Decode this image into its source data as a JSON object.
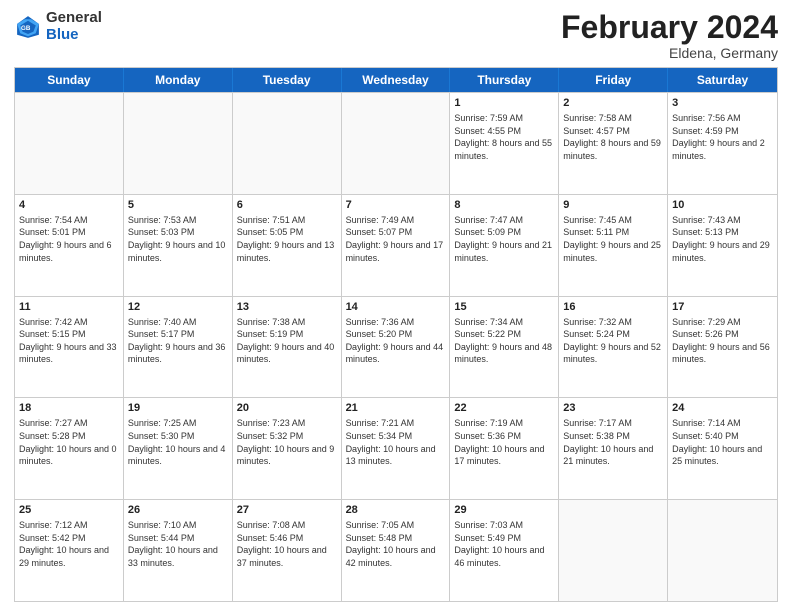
{
  "header": {
    "logo_general": "General",
    "logo_blue": "Blue",
    "title": "February 2024",
    "location": "Eldena, Germany"
  },
  "days_of_week": [
    "Sunday",
    "Monday",
    "Tuesday",
    "Wednesday",
    "Thursday",
    "Friday",
    "Saturday"
  ],
  "weeks": [
    [
      {
        "day": "",
        "sunrise": "",
        "sunset": "",
        "daylight": ""
      },
      {
        "day": "",
        "sunrise": "",
        "sunset": "",
        "daylight": ""
      },
      {
        "day": "",
        "sunrise": "",
        "sunset": "",
        "daylight": ""
      },
      {
        "day": "",
        "sunrise": "",
        "sunset": "",
        "daylight": ""
      },
      {
        "day": "1",
        "sunrise": "Sunrise: 7:59 AM",
        "sunset": "Sunset: 4:55 PM",
        "daylight": "Daylight: 8 hours and 55 minutes."
      },
      {
        "day": "2",
        "sunrise": "Sunrise: 7:58 AM",
        "sunset": "Sunset: 4:57 PM",
        "daylight": "Daylight: 8 hours and 59 minutes."
      },
      {
        "day": "3",
        "sunrise": "Sunrise: 7:56 AM",
        "sunset": "Sunset: 4:59 PM",
        "daylight": "Daylight: 9 hours and 2 minutes."
      }
    ],
    [
      {
        "day": "4",
        "sunrise": "Sunrise: 7:54 AM",
        "sunset": "Sunset: 5:01 PM",
        "daylight": "Daylight: 9 hours and 6 minutes."
      },
      {
        "day": "5",
        "sunrise": "Sunrise: 7:53 AM",
        "sunset": "Sunset: 5:03 PM",
        "daylight": "Daylight: 9 hours and 10 minutes."
      },
      {
        "day": "6",
        "sunrise": "Sunrise: 7:51 AM",
        "sunset": "Sunset: 5:05 PM",
        "daylight": "Daylight: 9 hours and 13 minutes."
      },
      {
        "day": "7",
        "sunrise": "Sunrise: 7:49 AM",
        "sunset": "Sunset: 5:07 PM",
        "daylight": "Daylight: 9 hours and 17 minutes."
      },
      {
        "day": "8",
        "sunrise": "Sunrise: 7:47 AM",
        "sunset": "Sunset: 5:09 PM",
        "daylight": "Daylight: 9 hours and 21 minutes."
      },
      {
        "day": "9",
        "sunrise": "Sunrise: 7:45 AM",
        "sunset": "Sunset: 5:11 PM",
        "daylight": "Daylight: 9 hours and 25 minutes."
      },
      {
        "day": "10",
        "sunrise": "Sunrise: 7:43 AM",
        "sunset": "Sunset: 5:13 PM",
        "daylight": "Daylight: 9 hours and 29 minutes."
      }
    ],
    [
      {
        "day": "11",
        "sunrise": "Sunrise: 7:42 AM",
        "sunset": "Sunset: 5:15 PM",
        "daylight": "Daylight: 9 hours and 33 minutes."
      },
      {
        "day": "12",
        "sunrise": "Sunrise: 7:40 AM",
        "sunset": "Sunset: 5:17 PM",
        "daylight": "Daylight: 9 hours and 36 minutes."
      },
      {
        "day": "13",
        "sunrise": "Sunrise: 7:38 AM",
        "sunset": "Sunset: 5:19 PM",
        "daylight": "Daylight: 9 hours and 40 minutes."
      },
      {
        "day": "14",
        "sunrise": "Sunrise: 7:36 AM",
        "sunset": "Sunset: 5:20 PM",
        "daylight": "Daylight: 9 hours and 44 minutes."
      },
      {
        "day": "15",
        "sunrise": "Sunrise: 7:34 AM",
        "sunset": "Sunset: 5:22 PM",
        "daylight": "Daylight: 9 hours and 48 minutes."
      },
      {
        "day": "16",
        "sunrise": "Sunrise: 7:32 AM",
        "sunset": "Sunset: 5:24 PM",
        "daylight": "Daylight: 9 hours and 52 minutes."
      },
      {
        "day": "17",
        "sunrise": "Sunrise: 7:29 AM",
        "sunset": "Sunset: 5:26 PM",
        "daylight": "Daylight: 9 hours and 56 minutes."
      }
    ],
    [
      {
        "day": "18",
        "sunrise": "Sunrise: 7:27 AM",
        "sunset": "Sunset: 5:28 PM",
        "daylight": "Daylight: 10 hours and 0 minutes."
      },
      {
        "day": "19",
        "sunrise": "Sunrise: 7:25 AM",
        "sunset": "Sunset: 5:30 PM",
        "daylight": "Daylight: 10 hours and 4 minutes."
      },
      {
        "day": "20",
        "sunrise": "Sunrise: 7:23 AM",
        "sunset": "Sunset: 5:32 PM",
        "daylight": "Daylight: 10 hours and 9 minutes."
      },
      {
        "day": "21",
        "sunrise": "Sunrise: 7:21 AM",
        "sunset": "Sunset: 5:34 PM",
        "daylight": "Daylight: 10 hours and 13 minutes."
      },
      {
        "day": "22",
        "sunrise": "Sunrise: 7:19 AM",
        "sunset": "Sunset: 5:36 PM",
        "daylight": "Daylight: 10 hours and 17 minutes."
      },
      {
        "day": "23",
        "sunrise": "Sunrise: 7:17 AM",
        "sunset": "Sunset: 5:38 PM",
        "daylight": "Daylight: 10 hours and 21 minutes."
      },
      {
        "day": "24",
        "sunrise": "Sunrise: 7:14 AM",
        "sunset": "Sunset: 5:40 PM",
        "daylight": "Daylight: 10 hours and 25 minutes."
      }
    ],
    [
      {
        "day": "25",
        "sunrise": "Sunrise: 7:12 AM",
        "sunset": "Sunset: 5:42 PM",
        "daylight": "Daylight: 10 hours and 29 minutes."
      },
      {
        "day": "26",
        "sunrise": "Sunrise: 7:10 AM",
        "sunset": "Sunset: 5:44 PM",
        "daylight": "Daylight: 10 hours and 33 minutes."
      },
      {
        "day": "27",
        "sunrise": "Sunrise: 7:08 AM",
        "sunset": "Sunset: 5:46 PM",
        "daylight": "Daylight: 10 hours and 37 minutes."
      },
      {
        "day": "28",
        "sunrise": "Sunrise: 7:05 AM",
        "sunset": "Sunset: 5:48 PM",
        "daylight": "Daylight: 10 hours and 42 minutes."
      },
      {
        "day": "29",
        "sunrise": "Sunrise: 7:03 AM",
        "sunset": "Sunset: 5:49 PM",
        "daylight": "Daylight: 10 hours and 46 minutes."
      },
      {
        "day": "",
        "sunrise": "",
        "sunset": "",
        "daylight": ""
      },
      {
        "day": "",
        "sunrise": "",
        "sunset": "",
        "daylight": ""
      }
    ]
  ]
}
